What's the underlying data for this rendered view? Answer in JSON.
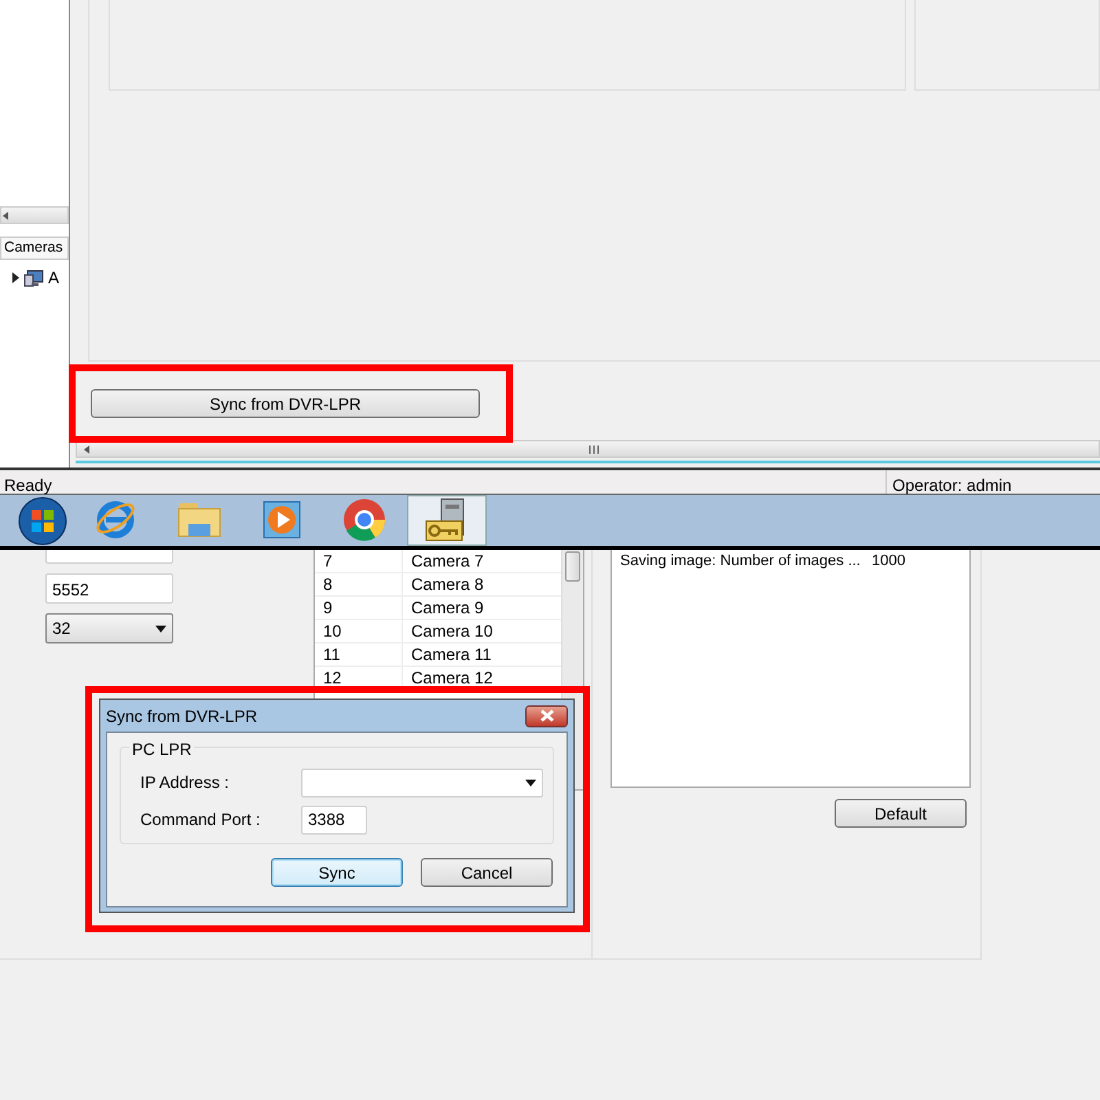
{
  "main_window": {
    "sidebar": {
      "tab": "Cameras",
      "tree": [
        {
          "label": "A",
          "expanded": false
        }
      ]
    },
    "sync_button": "Sync from DVR-LPR",
    "status_bar": {
      "status": "Ready",
      "operator": "Operator: admin"
    }
  },
  "taskbar": {
    "items": [
      {
        "kind": "start",
        "selected": false
      },
      {
        "kind": "browser",
        "selected": false
      },
      {
        "kind": "folder",
        "selected": false
      },
      {
        "kind": "media",
        "selected": false
      },
      {
        "kind": "chrome",
        "selected": false
      },
      {
        "kind": "app",
        "selected": true
      }
    ]
  },
  "settings_window": {
    "fields": [
      {
        "kind": "text"
      },
      {
        "kind": "text",
        "value": "5552"
      },
      {
        "kind": "select",
        "value": "32"
      }
    ],
    "cameras": [
      {
        "number": "7",
        "name": "Camera 7"
      },
      {
        "number": "8",
        "name": "Camera 8"
      },
      {
        "number": "9",
        "name": "Camera 9"
      },
      {
        "number": "10",
        "name": "Camera 10"
      },
      {
        "number": "11",
        "name": "Camera 11"
      },
      {
        "number": "12",
        "name": "Camera 12"
      }
    ],
    "settings_table": {
      "rows": [
        {
          "name": "Saving image: Number of images ...",
          "value": "1000"
        }
      ]
    },
    "default_button": "Default"
  },
  "dialog": {
    "title": "Sync from DVR-LPR",
    "group_label": "PC LPR",
    "fields": [
      {
        "label": "IP Address :",
        "kind": "select"
      },
      {
        "label": "Command Port :",
        "kind": "text",
        "value": "3388"
      }
    ],
    "buttons": [
      {
        "label": "Sync",
        "focused": true
      },
      {
        "label": "Cancel",
        "focused": false
      }
    ]
  }
}
